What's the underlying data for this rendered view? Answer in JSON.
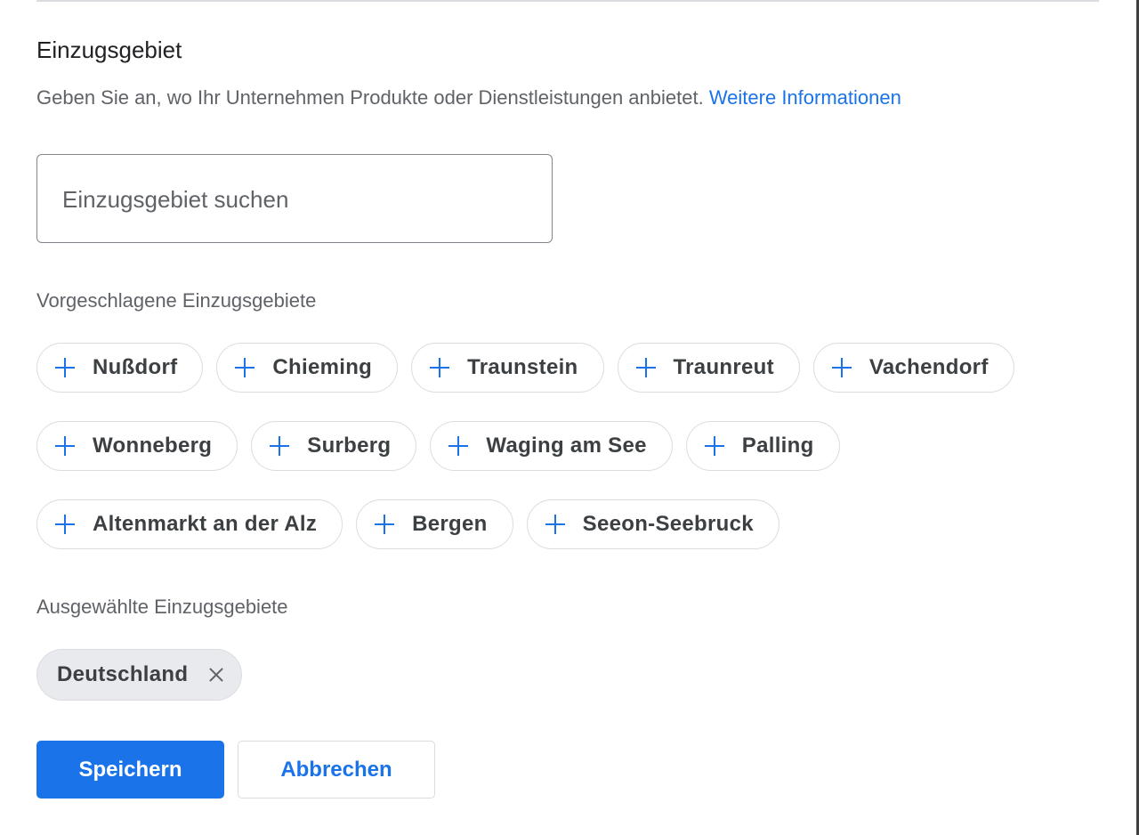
{
  "section": {
    "title": "Einzugsgebiet",
    "description": "Geben Sie an, wo Ihr Unternehmen Produkte oder Dienstleistungen anbietet.",
    "link_text": "Weitere Informationen"
  },
  "search": {
    "placeholder": "Einzugsgebiet suchen",
    "value": ""
  },
  "suggested": {
    "label": "Vorgeschlagene Einzugsgebiete",
    "items": [
      "Nußdorf",
      "Chieming",
      "Traunstein",
      "Traunreut",
      "Vachendorf",
      "Wonneberg",
      "Surberg",
      "Waging am See",
      "Palling",
      "Altenmarkt an der Alz",
      "Bergen",
      "Seeon-Seebruck"
    ]
  },
  "selected": {
    "label": "Ausgewählte Einzugsgebiete",
    "items": [
      "Deutschland"
    ]
  },
  "actions": {
    "save_label": "Speichern",
    "cancel_label": "Abbrechen"
  },
  "colors": {
    "accent": "#1a73e8",
    "text_primary": "#202124",
    "text_secondary": "#5f6368",
    "chip_border": "#dadce0",
    "selected_chip_bg": "#e8eaed"
  }
}
